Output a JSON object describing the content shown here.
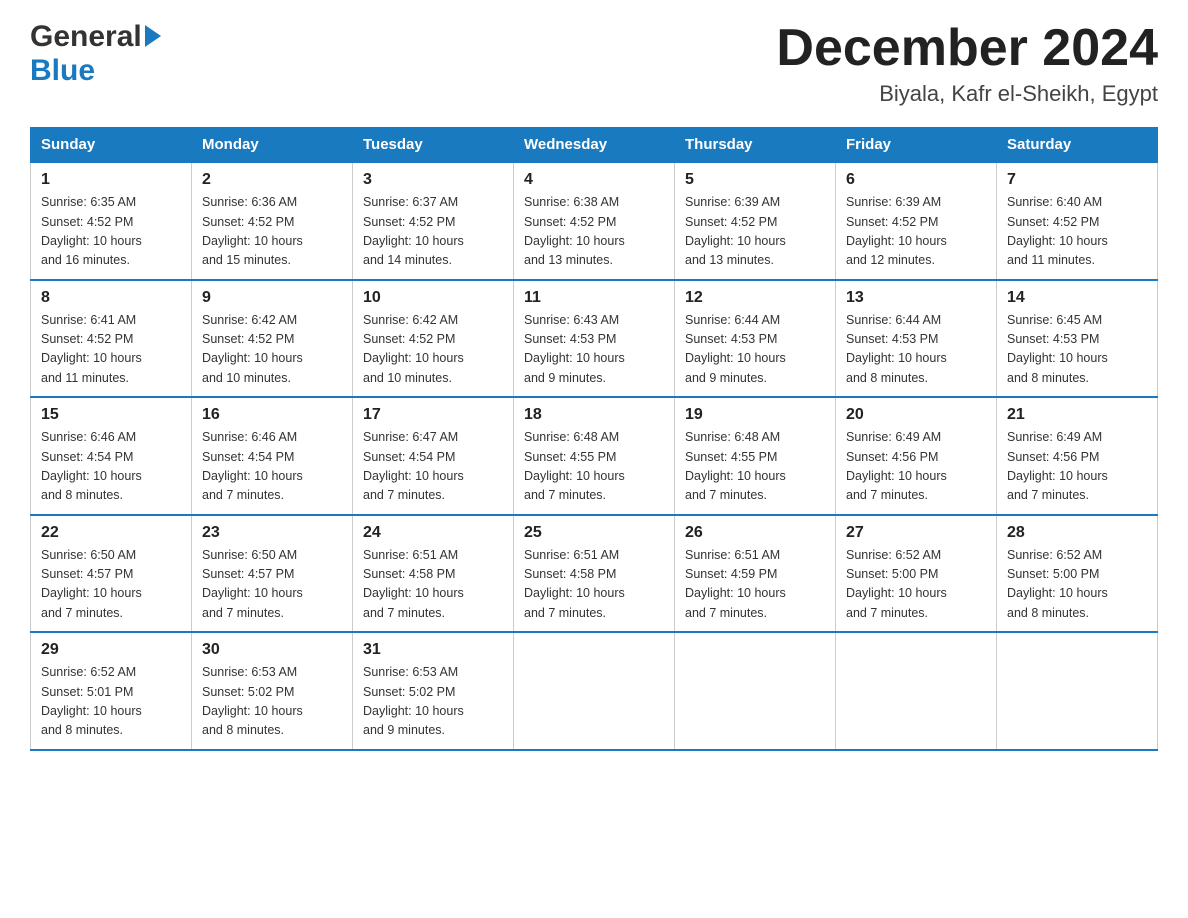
{
  "header": {
    "logo_general": "General",
    "logo_blue": "Blue",
    "month_title": "December 2024",
    "location": "Biyala, Kafr el-Sheikh, Egypt"
  },
  "days_of_week": [
    "Sunday",
    "Monday",
    "Tuesday",
    "Wednesday",
    "Thursday",
    "Friday",
    "Saturday"
  ],
  "weeks": [
    [
      {
        "day": "1",
        "sunrise": "6:35 AM",
        "sunset": "4:52 PM",
        "daylight": "10 hours and 16 minutes."
      },
      {
        "day": "2",
        "sunrise": "6:36 AM",
        "sunset": "4:52 PM",
        "daylight": "10 hours and 15 minutes."
      },
      {
        "day": "3",
        "sunrise": "6:37 AM",
        "sunset": "4:52 PM",
        "daylight": "10 hours and 14 minutes."
      },
      {
        "day": "4",
        "sunrise": "6:38 AM",
        "sunset": "4:52 PM",
        "daylight": "10 hours and 13 minutes."
      },
      {
        "day": "5",
        "sunrise": "6:39 AM",
        "sunset": "4:52 PM",
        "daylight": "10 hours and 13 minutes."
      },
      {
        "day": "6",
        "sunrise": "6:39 AM",
        "sunset": "4:52 PM",
        "daylight": "10 hours and 12 minutes."
      },
      {
        "day": "7",
        "sunrise": "6:40 AM",
        "sunset": "4:52 PM",
        "daylight": "10 hours and 11 minutes."
      }
    ],
    [
      {
        "day": "8",
        "sunrise": "6:41 AM",
        "sunset": "4:52 PM",
        "daylight": "10 hours and 11 minutes."
      },
      {
        "day": "9",
        "sunrise": "6:42 AM",
        "sunset": "4:52 PM",
        "daylight": "10 hours and 10 minutes."
      },
      {
        "day": "10",
        "sunrise": "6:42 AM",
        "sunset": "4:52 PM",
        "daylight": "10 hours and 10 minutes."
      },
      {
        "day": "11",
        "sunrise": "6:43 AM",
        "sunset": "4:53 PM",
        "daylight": "10 hours and 9 minutes."
      },
      {
        "day": "12",
        "sunrise": "6:44 AM",
        "sunset": "4:53 PM",
        "daylight": "10 hours and 9 minutes."
      },
      {
        "day": "13",
        "sunrise": "6:44 AM",
        "sunset": "4:53 PM",
        "daylight": "10 hours and 8 minutes."
      },
      {
        "day": "14",
        "sunrise": "6:45 AM",
        "sunset": "4:53 PM",
        "daylight": "10 hours and 8 minutes."
      }
    ],
    [
      {
        "day": "15",
        "sunrise": "6:46 AM",
        "sunset": "4:54 PM",
        "daylight": "10 hours and 8 minutes."
      },
      {
        "day": "16",
        "sunrise": "6:46 AM",
        "sunset": "4:54 PM",
        "daylight": "10 hours and 7 minutes."
      },
      {
        "day": "17",
        "sunrise": "6:47 AM",
        "sunset": "4:54 PM",
        "daylight": "10 hours and 7 minutes."
      },
      {
        "day": "18",
        "sunrise": "6:48 AM",
        "sunset": "4:55 PM",
        "daylight": "10 hours and 7 minutes."
      },
      {
        "day": "19",
        "sunrise": "6:48 AM",
        "sunset": "4:55 PM",
        "daylight": "10 hours and 7 minutes."
      },
      {
        "day": "20",
        "sunrise": "6:49 AM",
        "sunset": "4:56 PM",
        "daylight": "10 hours and 7 minutes."
      },
      {
        "day": "21",
        "sunrise": "6:49 AM",
        "sunset": "4:56 PM",
        "daylight": "10 hours and 7 minutes."
      }
    ],
    [
      {
        "day": "22",
        "sunrise": "6:50 AM",
        "sunset": "4:57 PM",
        "daylight": "10 hours and 7 minutes."
      },
      {
        "day": "23",
        "sunrise": "6:50 AM",
        "sunset": "4:57 PM",
        "daylight": "10 hours and 7 minutes."
      },
      {
        "day": "24",
        "sunrise": "6:51 AM",
        "sunset": "4:58 PM",
        "daylight": "10 hours and 7 minutes."
      },
      {
        "day": "25",
        "sunrise": "6:51 AM",
        "sunset": "4:58 PM",
        "daylight": "10 hours and 7 minutes."
      },
      {
        "day": "26",
        "sunrise": "6:51 AM",
        "sunset": "4:59 PM",
        "daylight": "10 hours and 7 minutes."
      },
      {
        "day": "27",
        "sunrise": "6:52 AM",
        "sunset": "5:00 PM",
        "daylight": "10 hours and 7 minutes."
      },
      {
        "day": "28",
        "sunrise": "6:52 AM",
        "sunset": "5:00 PM",
        "daylight": "10 hours and 8 minutes."
      }
    ],
    [
      {
        "day": "29",
        "sunrise": "6:52 AM",
        "sunset": "5:01 PM",
        "daylight": "10 hours and 8 minutes."
      },
      {
        "day": "30",
        "sunrise": "6:53 AM",
        "sunset": "5:02 PM",
        "daylight": "10 hours and 8 minutes."
      },
      {
        "day": "31",
        "sunrise": "6:53 AM",
        "sunset": "5:02 PM",
        "daylight": "10 hours and 9 minutes."
      },
      null,
      null,
      null,
      null
    ]
  ],
  "labels": {
    "sunrise": "Sunrise:",
    "sunset": "Sunset:",
    "daylight": "Daylight:"
  }
}
